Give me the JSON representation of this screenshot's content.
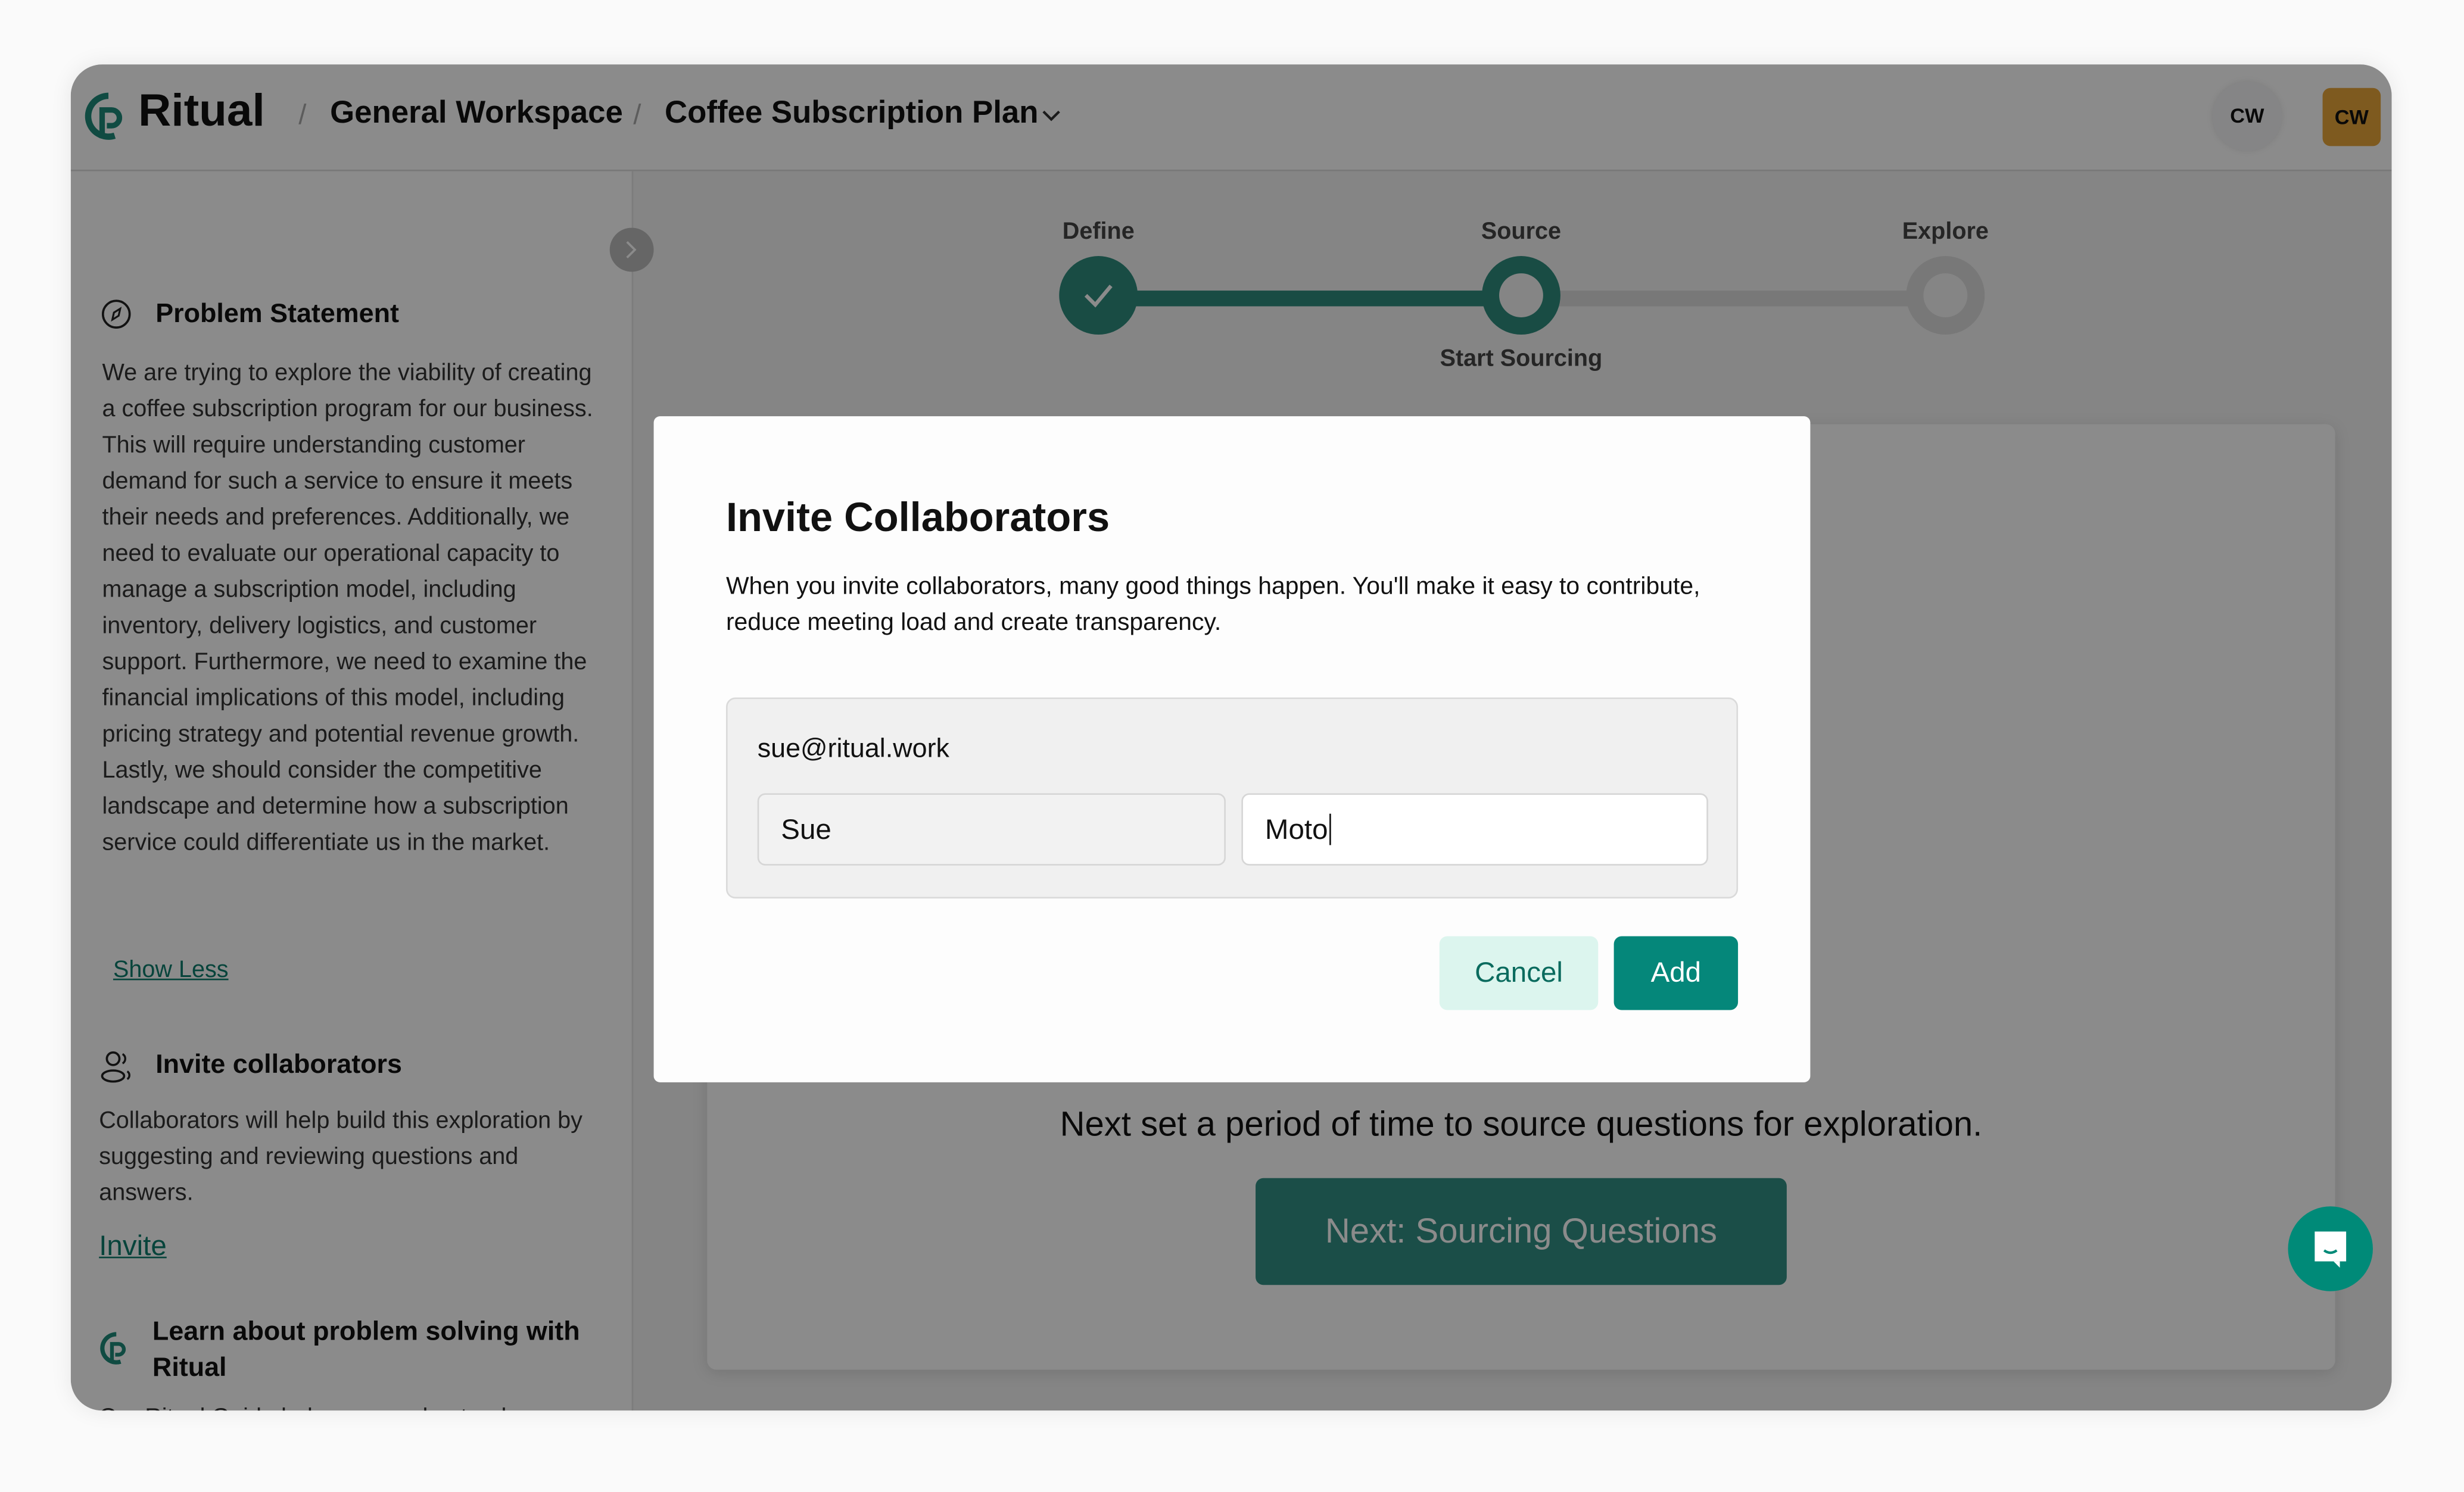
{
  "header": {
    "logo": "Ritual",
    "breadcrumbs": [
      "General Workspace",
      "Coffee Subscription Plan"
    ],
    "separator": "/",
    "avatars": [
      "CW",
      "CW"
    ]
  },
  "sidebar": {
    "problem": {
      "title": "Problem Statement",
      "body": "We are trying to explore the viability of creating a coffee subscription program for our business. This will require understanding customer demand for such a service to ensure it meets their needs and preferences. Additionally, we need to evaluate our operational capacity to manage a subscription model, including inventory, delivery logistics, and customer support. Furthermore, we need to examine the financial implications of this model, including pricing strategy and potential revenue growth. Lastly, we should consider the competitive landscape and determine how a subscription service could differentiate us in the market.",
      "toggle": "Show Less"
    },
    "invite": {
      "title": "Invite collaborators",
      "body": "Collaborators will help build this exploration by suggesting and reviewing questions and answers.",
      "link": "Invite"
    },
    "learn": {
      "title": "Learn about problem solving with Ritual",
      "body": "Our Ritual Guide helps you understand exploration workflow and key roles to"
    }
  },
  "stepper": {
    "steps": [
      {
        "label": "Define",
        "status": "complete"
      },
      {
        "label": "Source",
        "status": "current",
        "sublabel": "Start Sourcing"
      },
      {
        "label": "Explore",
        "status": "upcoming"
      }
    ]
  },
  "main": {
    "prompt": "Next set a period of time to source questions for exploration.",
    "next_button": "Next: Sourcing Questions"
  },
  "modal": {
    "title": "Invite Collaborators",
    "description": "When you invite collaborators, many good things happen. You'll make it easy to contribute, reduce meeting load and create transparency.",
    "email": "sue@ritual.work",
    "first_name": "Sue",
    "last_name": "Moto",
    "cancel": "Cancel",
    "add": "Add"
  },
  "colors": {
    "brand": "#0a8a78",
    "avatar_gold": "#e8a53a",
    "cancel_bg": "#dcf5ee"
  }
}
